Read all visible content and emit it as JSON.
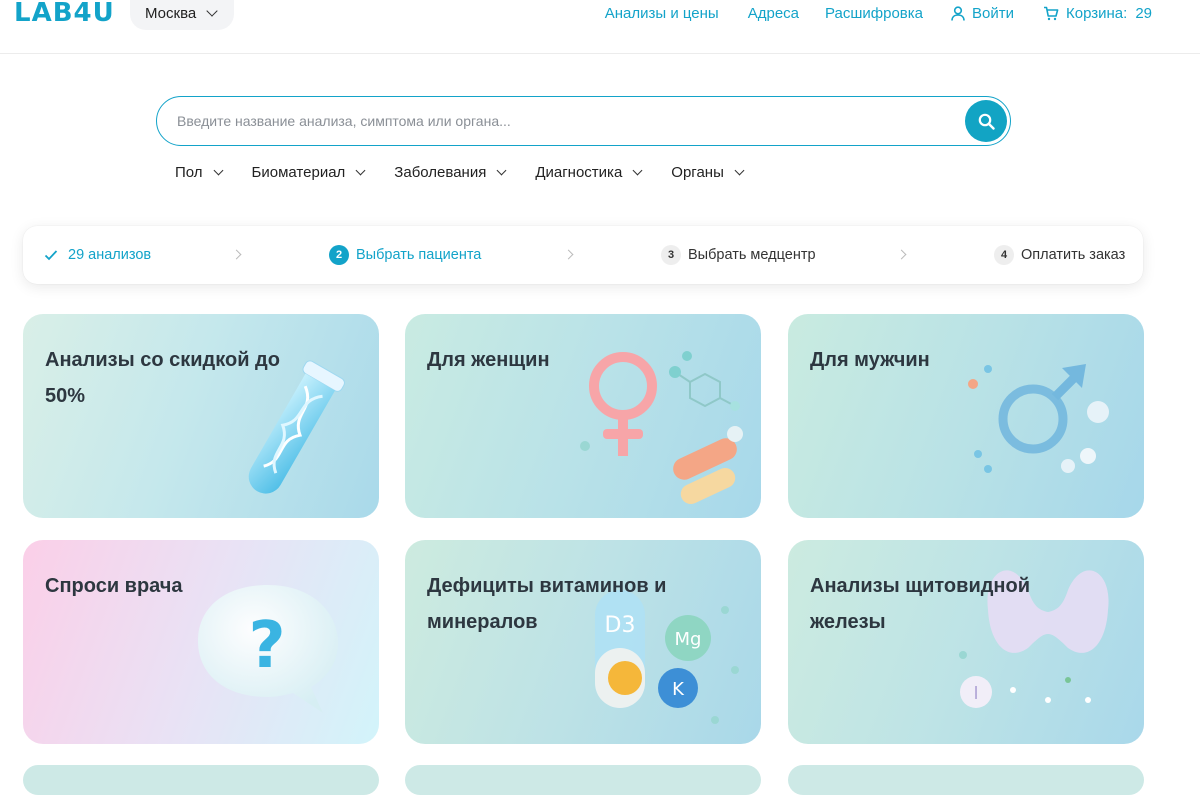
{
  "header": {
    "logo": "LAB4U",
    "city": "Москва",
    "nav": {
      "tests": "Анализы и цены",
      "addresses": "Адреса",
      "decoding": "Расшифровка",
      "login": "Войти",
      "cart_label": "Корзина:",
      "cart_count": "29"
    }
  },
  "search": {
    "placeholder": "Введите название анализа, симптома или органа..."
  },
  "filters": [
    "Пол",
    "Биоматериал",
    "Заболевания",
    "Диагностика",
    "Органы"
  ],
  "steps": [
    {
      "num": "✓",
      "label": "29 анализов"
    },
    {
      "num": "2",
      "label": "Выбрать пациента"
    },
    {
      "num": "3",
      "label": "Выбрать медцентр"
    },
    {
      "num": "4",
      "label": "Оплатить заказ"
    }
  ],
  "cards": [
    {
      "title": "Анализы со скидкой до 50%"
    },
    {
      "title": "Для женщин"
    },
    {
      "title": "Для мужчин"
    },
    {
      "title": "Спроси врача"
    },
    {
      "title": "Дефициты витаминов и минералов"
    },
    {
      "title": "Анализы щитовидной железы"
    }
  ],
  "colors": {
    "accent": "#13a3c9",
    "text": "#2d3740"
  },
  "icons": [
    "chevron-down-icon",
    "search-icon",
    "user-icon",
    "cart-icon",
    "check-icon",
    "chevron-right-icon"
  ],
  "illustrations": {
    "vitamins": [
      "D3",
      "Mg",
      "K"
    ],
    "thyroid": "I"
  }
}
